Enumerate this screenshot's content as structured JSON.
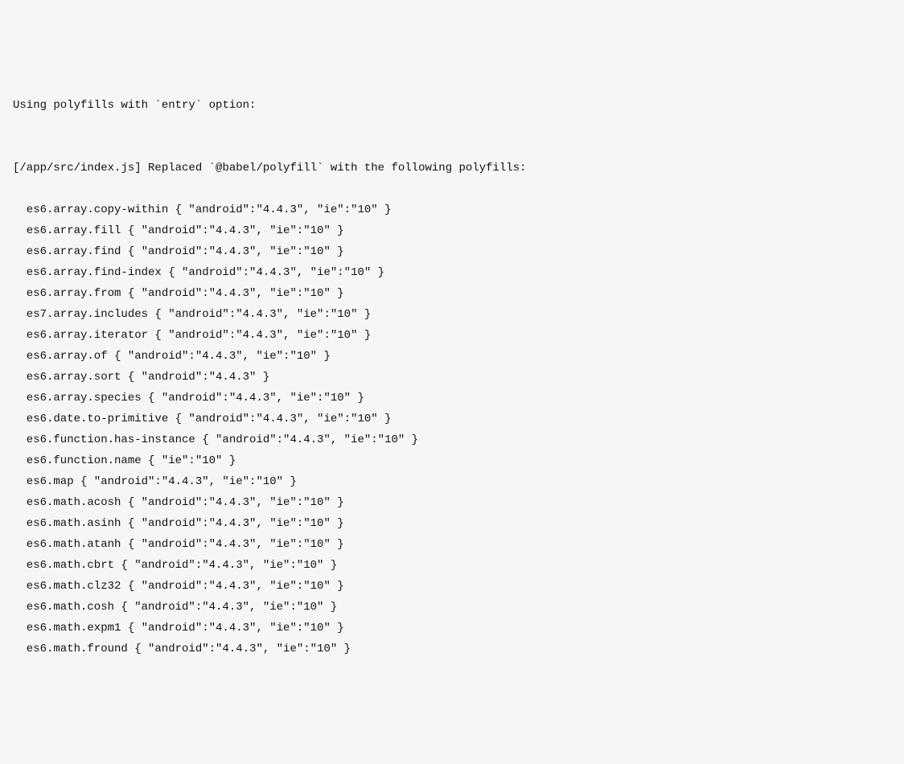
{
  "header": "Using polyfills with `entry` option:",
  "blank": "",
  "replaced": "[/app/src/index.js] Replaced `@babel/polyfill` with the following polyfills:",
  "polyfills": [
    {
      "name": "es6.array.copy-within",
      "targets": "{ \"android\":\"4.4.3\", \"ie\":\"10\" }"
    },
    {
      "name": "es6.array.fill",
      "targets": "{ \"android\":\"4.4.3\", \"ie\":\"10\" }"
    },
    {
      "name": "es6.array.find",
      "targets": "{ \"android\":\"4.4.3\", \"ie\":\"10\" }"
    },
    {
      "name": "es6.array.find-index",
      "targets": "{ \"android\":\"4.4.3\", \"ie\":\"10\" }"
    },
    {
      "name": "es6.array.from",
      "targets": "{ \"android\":\"4.4.3\", \"ie\":\"10\" }"
    },
    {
      "name": "es7.array.includes",
      "targets": "{ \"android\":\"4.4.3\", \"ie\":\"10\" }"
    },
    {
      "name": "es6.array.iterator",
      "targets": "{ \"android\":\"4.4.3\", \"ie\":\"10\" }"
    },
    {
      "name": "es6.array.of",
      "targets": "{ \"android\":\"4.4.3\", \"ie\":\"10\" }"
    },
    {
      "name": "es6.array.sort",
      "targets": "{ \"android\":\"4.4.3\" }"
    },
    {
      "name": "es6.array.species",
      "targets": "{ \"android\":\"4.4.3\", \"ie\":\"10\" }"
    },
    {
      "name": "es6.date.to-primitive",
      "targets": "{ \"android\":\"4.4.3\", \"ie\":\"10\" }"
    },
    {
      "name": "es6.function.has-instance",
      "targets": "{ \"android\":\"4.4.3\", \"ie\":\"10\" }"
    },
    {
      "name": "es6.function.name",
      "targets": "{ \"ie\":\"10\" }"
    },
    {
      "name": "es6.map",
      "targets": "{ \"android\":\"4.4.3\", \"ie\":\"10\" }"
    },
    {
      "name": "es6.math.acosh",
      "targets": "{ \"android\":\"4.4.3\", \"ie\":\"10\" }"
    },
    {
      "name": "es6.math.asinh",
      "targets": "{ \"android\":\"4.4.3\", \"ie\":\"10\" }"
    },
    {
      "name": "es6.math.atanh",
      "targets": "{ \"android\":\"4.4.3\", \"ie\":\"10\" }"
    },
    {
      "name": "es6.math.cbrt",
      "targets": "{ \"android\":\"4.4.3\", \"ie\":\"10\" }"
    },
    {
      "name": "es6.math.clz32",
      "targets": "{ \"android\":\"4.4.3\", \"ie\":\"10\" }"
    },
    {
      "name": "es6.math.cosh",
      "targets": "{ \"android\":\"4.4.3\", \"ie\":\"10\" }"
    },
    {
      "name": "es6.math.expm1",
      "targets": "{ \"android\":\"4.4.3\", \"ie\":\"10\" }"
    },
    {
      "name": "es6.math.fround",
      "targets": "{ \"android\":\"4.4.3\", \"ie\":\"10\" }"
    }
  ]
}
